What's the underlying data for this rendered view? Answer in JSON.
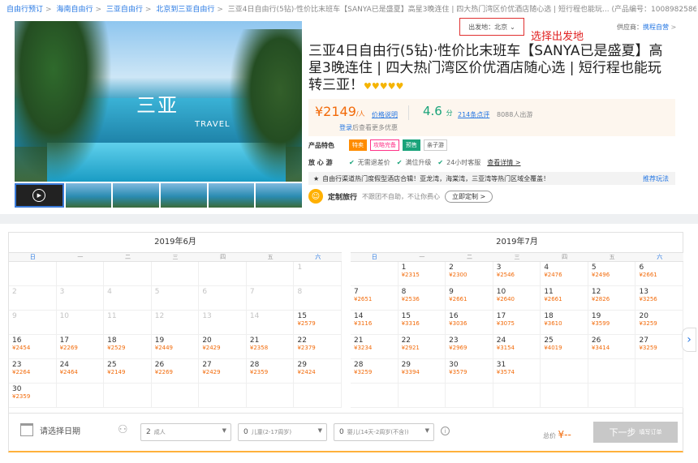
{
  "breadcrumb": {
    "items": [
      "自由行预订",
      "海南自由行",
      "三亚自由行",
      "北京到三亚自由行"
    ],
    "current": "三亚4日自由行(5钻)·性价比末班车【SANYA已是盛夏】高星3晚连住 | 四大热门湾区价优酒店随心选 | 短行程也能玩...",
    "product_id": "(产品编号：1008982586)"
  },
  "gallery": {
    "overlay_title": "三亚",
    "overlay_sub": "TRAVEL"
  },
  "departure": {
    "label": "出发地：北京",
    "annotation": "选择出发地"
  },
  "supplier": {
    "prefix": "供应商：",
    "name": "携程自营"
  },
  "product": {
    "title": "三亚4日自由行(5钻)·性价比末班车【SANYA已是盛夏】高星3晚连住 | 四大热门湾区价优酒店随心选 | 短行程也能玩转三亚！",
    "rating_hearts": "♥♥♥♥♥"
  },
  "pricing": {
    "price": "¥2149",
    "unit": "/人",
    "price_note": "价格说明",
    "score": "4.6",
    "score_unit": "分",
    "reviews": "214条点评",
    "travelers": "8088人出游",
    "login": "登录",
    "login_tail": "后查看更多优惠"
  },
  "features": {
    "label": "产品特色",
    "tags": [
      "特卖",
      "攻略完备",
      "预售",
      "亲子游"
    ]
  },
  "guarantee": {
    "label": "放 心 游",
    "items": [
      "无需退差价",
      "满位升级",
      "24小时客服"
    ],
    "detail": "查看详情 >"
  },
  "promo": {
    "text": "自由行渠道热门度假型酒店合辑！亚龙湾，海棠湾，三亚湾等热门区域全覆盖！",
    "more": "推荐玩法"
  },
  "custom": {
    "label": "定制旅行",
    "desc": "不跟团不自助，不让你费心",
    "button": "立即定制 >"
  },
  "weekdays": [
    "日",
    "一",
    "二",
    "三",
    "四",
    "五",
    "六"
  ],
  "months": [
    {
      "title": "2019年6月",
      "weeks": [
        [
          {
            "d": ""
          },
          {
            "d": ""
          },
          {
            "d": ""
          },
          {
            "d": ""
          },
          {
            "d": ""
          },
          {
            "d": ""
          },
          {
            "d": "1",
            "g": true
          }
        ],
        [
          {
            "d": "2",
            "g": true
          },
          {
            "d": "3",
            "g": true
          },
          {
            "d": "4",
            "g": true
          },
          {
            "d": "5",
            "g": true
          },
          {
            "d": "6",
            "g": true
          },
          {
            "d": "7",
            "g": true
          },
          {
            "d": "8",
            "g": true
          }
        ],
        [
          {
            "d": "9",
            "g": true
          },
          {
            "d": "10",
            "g": true
          },
          {
            "d": "11",
            "g": true
          },
          {
            "d": "12",
            "g": true
          },
          {
            "d": "13",
            "g": true
          },
          {
            "d": "14",
            "g": true
          },
          {
            "d": "15",
            "p": "¥2579"
          }
        ],
        [
          {
            "d": "16",
            "p": "¥2454"
          },
          {
            "d": "17",
            "p": "¥2269"
          },
          {
            "d": "18",
            "p": "¥2529"
          },
          {
            "d": "19",
            "p": "¥2449"
          },
          {
            "d": "20",
            "p": "¥2429"
          },
          {
            "d": "21",
            "p": "¥2358"
          },
          {
            "d": "22",
            "p": "¥2379"
          }
        ],
        [
          {
            "d": "23",
            "p": "¥2264"
          },
          {
            "d": "24",
            "p": "¥2464"
          },
          {
            "d": "25",
            "p": "¥2149"
          },
          {
            "d": "26",
            "p": "¥2269"
          },
          {
            "d": "27",
            "p": "¥2429"
          },
          {
            "d": "28",
            "p": "¥2359"
          },
          {
            "d": "29",
            "p": "¥2424"
          }
        ],
        [
          {
            "d": "30",
            "p": "¥2359"
          },
          {
            "d": ""
          },
          {
            "d": ""
          },
          {
            "d": ""
          },
          {
            "d": ""
          },
          {
            "d": ""
          },
          {
            "d": ""
          }
        ]
      ]
    },
    {
      "title": "2019年7月",
      "weeks": [
        [
          {
            "d": ""
          },
          {
            "d": "1",
            "p": "¥2315"
          },
          {
            "d": "2",
            "p": "¥2300"
          },
          {
            "d": "3",
            "p": "¥2546"
          },
          {
            "d": "4",
            "p": "¥2476"
          },
          {
            "d": "5",
            "p": "¥2496"
          },
          {
            "d": "6",
            "p": "¥2661"
          }
        ],
        [
          {
            "d": "7",
            "p": "¥2651"
          },
          {
            "d": "8",
            "p": "¥2536"
          },
          {
            "d": "9",
            "p": "¥2661"
          },
          {
            "d": "10",
            "p": "¥2640"
          },
          {
            "d": "11",
            "p": "¥2661"
          },
          {
            "d": "12",
            "p": "¥2826"
          },
          {
            "d": "13",
            "p": "¥3256"
          }
        ],
        [
          {
            "d": "14",
            "p": "¥3116"
          },
          {
            "d": "15",
            "p": "¥3316"
          },
          {
            "d": "16",
            "p": "¥3036"
          },
          {
            "d": "17",
            "p": "¥3075"
          },
          {
            "d": "18",
            "p": "¥3610"
          },
          {
            "d": "19",
            "p": "¥3599"
          },
          {
            "d": "20",
            "p": "¥3259"
          }
        ],
        [
          {
            "d": "21",
            "p": "¥3234"
          },
          {
            "d": "22",
            "p": "¥2921"
          },
          {
            "d": "23",
            "p": "¥2969"
          },
          {
            "d": "24",
            "p": "¥3154"
          },
          {
            "d": "25",
            "p": "¥4019"
          },
          {
            "d": "26",
            "p": "¥3414"
          },
          {
            "d": "27",
            "p": "¥3259"
          }
        ],
        [
          {
            "d": "28",
            "p": "¥3259"
          },
          {
            "d": "29",
            "p": "¥3394"
          },
          {
            "d": "30",
            "p": "¥3579"
          },
          {
            "d": "31",
            "p": "¥3574"
          },
          {
            "d": ""
          },
          {
            "d": ""
          },
          {
            "d": ""
          }
        ],
        [
          {
            "d": ""
          },
          {
            "d": ""
          },
          {
            "d": ""
          },
          {
            "d": ""
          },
          {
            "d": ""
          },
          {
            "d": ""
          },
          {
            "d": ""
          }
        ]
      ]
    }
  ],
  "booking": {
    "date_placeholder": "请选择日期",
    "adults": {
      "value": "2",
      "label": "成人"
    },
    "children": {
      "value": "0",
      "label": "儿童(2-17周岁)"
    },
    "infants": {
      "value": "0",
      "label": "婴儿(14天-2周岁(不含))"
    },
    "total_label": "总价",
    "total_value": "¥--",
    "next_label": "下一步",
    "next_sub": "填写订单"
  },
  "colors": {
    "accent": "#f26a09",
    "link": "#2577e3",
    "green": "#1aa37a",
    "annotation": "#e02020"
  }
}
